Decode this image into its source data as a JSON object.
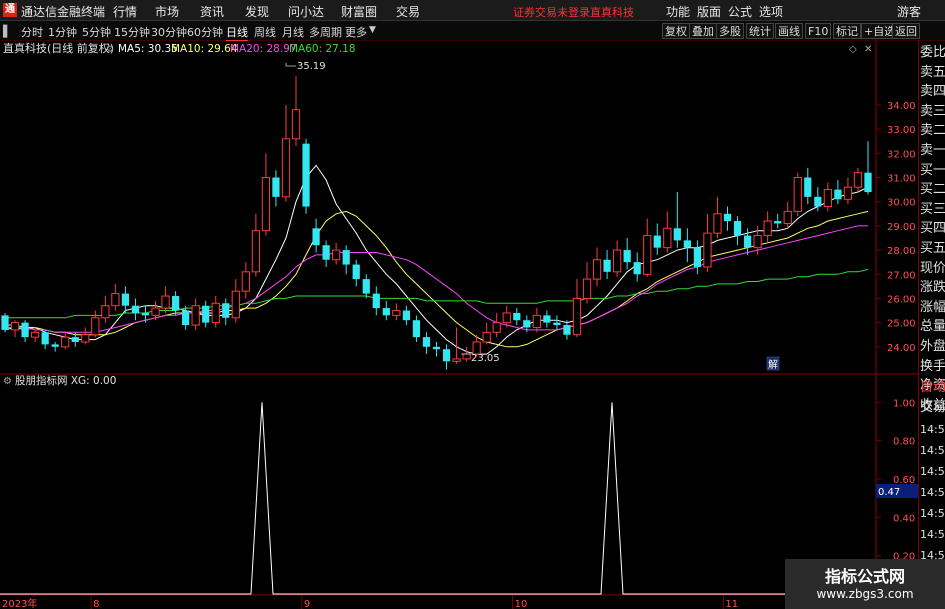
{
  "titlebar": {
    "app_name": "通达信金融终端",
    "menus": [
      "行情",
      "市场",
      "资讯",
      "发现",
      "问小达",
      "财富圈",
      "交易"
    ],
    "status_text": "证券交易未登录",
    "stock_name": "直真科技",
    "right_menus": [
      "功能",
      "版面",
      "公式",
      "选项"
    ],
    "user": "游客"
  },
  "toolbar": {
    "periods": [
      "分时",
      "1分钟",
      "5分钟",
      "15分钟",
      "30分钟",
      "60分钟",
      "日线",
      "周线",
      "月线",
      "多周期",
      "更多"
    ],
    "active_period": "日线",
    "right_buttons": [
      "复权",
      "叠加",
      "多股",
      "统计",
      "画线",
      "F10",
      "标记",
      "+自选",
      "返回"
    ]
  },
  "main_panel": {
    "header": "直真科技(日线 前复权)",
    "ma": [
      {
        "label": "MA5: 30.35",
        "color": "#ffffff"
      },
      {
        "label": "MA10: 29.64",
        "color": "#ffff66"
      },
      {
        "label": "MA20: 28.97",
        "color": "#ff44ff"
      },
      {
        "label": "MA60: 27.18",
        "color": "#33dd33"
      }
    ],
    "high_label": "35.19",
    "low_label": "23.05",
    "badge": "解"
  },
  "indicator_panel": {
    "header": "股朋指标网  XG: 0.00",
    "crosshair_value": "0.47"
  },
  "right_panel": {
    "items": [
      "委比",
      "卖五",
      "卖四",
      "卖三",
      "卖二",
      "卖一",
      "买一",
      "买二",
      "买三",
      "买四",
      "买五",
      "现价",
      "涨跌",
      "涨幅",
      "总量",
      "外盘",
      "换手",
      "净资",
      "收益",
      "自动",
      "交易"
    ],
    "times": [
      "14:56",
      "14:56",
      "14:56",
      "14:56",
      "14:56",
      "14:56",
      "14:56",
      "14:56"
    ]
  },
  "watermark": {
    "line1": "指标公式网",
    "line2": "www.zbgs3.com"
  },
  "colors": {
    "up": "#ff3a3a",
    "down": "#33e6f0",
    "ma5": "#ffffff",
    "ma10": "#ffff66",
    "ma20": "#ff44ff",
    "ma60": "#33dd33",
    "grid": "#7a0000",
    "axis_text": "#ff5050"
  },
  "chart_data": [
    {
      "type": "candlestick",
      "title": "直真科技(日线 前复权)",
      "x_months": [
        "2023年",
        "8",
        "9",
        "10",
        "11"
      ],
      "y_ticks": [
        24,
        25,
        26,
        27,
        28,
        29,
        30,
        31,
        32,
        33,
        34
      ],
      "ylim": [
        23.0,
        35.9
      ],
      "candles": [
        [
          25.3,
          24.7,
          25.4,
          24.6
        ],
        [
          24.7,
          25.0,
          25.1,
          24.4
        ],
        [
          25.0,
          24.4,
          25.1,
          24.2
        ],
        [
          24.4,
          24.6,
          24.8,
          24.2
        ],
        [
          24.6,
          24.1,
          24.7,
          23.9
        ],
        [
          24.1,
          24.0,
          24.2,
          23.8
        ],
        [
          24.0,
          24.4,
          24.6,
          23.9
        ],
        [
          24.4,
          24.2,
          24.6,
          24.0
        ],
        [
          24.2,
          24.5,
          24.8,
          24.1
        ],
        [
          24.5,
          25.2,
          25.5,
          24.4
        ],
        [
          25.2,
          25.7,
          26.1,
          25.0
        ],
        [
          25.7,
          26.2,
          26.6,
          25.5
        ],
        [
          26.2,
          25.7,
          26.5,
          25.4
        ],
        [
          25.7,
          25.4,
          26.0,
          25.1
        ],
        [
          25.4,
          25.3,
          25.7,
          25.0
        ],
        [
          25.3,
          25.6,
          25.9,
          25.1
        ],
        [
          25.6,
          26.1,
          26.5,
          25.4
        ],
        [
          26.1,
          25.5,
          26.3,
          25.3
        ],
        [
          25.5,
          24.9,
          25.7,
          24.7
        ],
        [
          24.9,
          25.7,
          26.0,
          24.7
        ],
        [
          25.7,
          25.0,
          25.9,
          24.8
        ],
        [
          25.0,
          25.8,
          26.1,
          24.8
        ],
        [
          25.8,
          25.2,
          26.0,
          24.9
        ],
        [
          25.2,
          26.3,
          26.8,
          25.0
        ],
        [
          26.3,
          27.1,
          27.5,
          26.0
        ],
        [
          27.1,
          28.8,
          29.5,
          26.9
        ],
        [
          28.8,
          31.0,
          32.0,
          28.6
        ],
        [
          31.0,
          30.2,
          31.3,
          29.8
        ],
        [
          30.2,
          32.6,
          34.0,
          30.0
        ],
        [
          32.6,
          33.8,
          35.19,
          32.3
        ],
        [
          32.4,
          29.8,
          32.6,
          29.5
        ],
        [
          28.9,
          28.2,
          29.3,
          27.9
        ],
        [
          28.2,
          27.6,
          28.4,
          27.3
        ],
        [
          27.6,
          28.0,
          28.3,
          27.4
        ],
        [
          28.0,
          27.4,
          28.2,
          27.0
        ],
        [
          27.4,
          26.8,
          27.6,
          26.5
        ],
        [
          26.8,
          26.2,
          27.0,
          26.0
        ],
        [
          26.2,
          25.6,
          26.5,
          25.3
        ],
        [
          25.6,
          25.3,
          25.9,
          25.1
        ],
        [
          25.3,
          25.5,
          25.8,
          25.1
        ],
        [
          25.5,
          25.1,
          25.7,
          24.9
        ],
        [
          25.1,
          24.4,
          25.3,
          24.2
        ],
        [
          24.4,
          24.0,
          24.6,
          23.7
        ],
        [
          24.0,
          23.9,
          24.2,
          23.6
        ],
        [
          23.9,
          23.4,
          24.1,
          23.05
        ],
        [
          23.4,
          23.5,
          24.8,
          23.3
        ],
        [
          23.5,
          23.7,
          24.0,
          23.4
        ],
        [
          23.7,
          24.2,
          24.5,
          23.6
        ],
        [
          24.2,
          24.6,
          25.0,
          24.1
        ],
        [
          24.6,
          25.0,
          25.4,
          24.4
        ],
        [
          25.0,
          25.4,
          25.7,
          24.8
        ],
        [
          25.4,
          25.1,
          25.6,
          24.9
        ],
        [
          25.1,
          24.8,
          25.3,
          24.6
        ],
        [
          24.8,
          25.3,
          25.6,
          24.6
        ],
        [
          25.3,
          25.0,
          25.5,
          24.8
        ],
        [
          25.0,
          24.9,
          25.3,
          24.7
        ],
        [
          24.9,
          24.5,
          25.1,
          24.3
        ],
        [
          24.5,
          26.0,
          26.8,
          24.4
        ],
        [
          26.0,
          26.8,
          27.5,
          25.8
        ],
        [
          26.8,
          27.6,
          28.1,
          26.5
        ],
        [
          27.6,
          27.1,
          28.0,
          26.8
        ],
        [
          27.1,
          28.0,
          28.4,
          26.9
        ],
        [
          28.0,
          27.5,
          28.5,
          27.2
        ],
        [
          27.5,
          27.0,
          27.9,
          26.7
        ],
        [
          27.0,
          28.6,
          29.3,
          26.9
        ],
        [
          28.6,
          28.1,
          29.1,
          27.8
        ],
        [
          28.1,
          28.9,
          29.6,
          27.9
        ],
        [
          28.9,
          28.4,
          30.4,
          28.1
        ],
        [
          28.4,
          28.1,
          28.9,
          27.5
        ],
        [
          28.1,
          27.3,
          28.4,
          27.0
        ],
        [
          27.3,
          28.7,
          29.5,
          27.1
        ],
        [
          28.7,
          29.5,
          30.2,
          28.5
        ],
        [
          29.5,
          29.2,
          29.8,
          28.8
        ],
        [
          29.2,
          28.6,
          29.4,
          28.2
        ],
        [
          28.6,
          28.1,
          28.9,
          27.8
        ],
        [
          28.1,
          28.6,
          29.0,
          27.8
        ],
        [
          28.6,
          29.2,
          29.6,
          28.3
        ],
        [
          29.2,
          29.1,
          29.5,
          28.9
        ],
        [
          29.1,
          29.6,
          30.0,
          28.9
        ],
        [
          29.6,
          31.0,
          31.2,
          29.4
        ],
        [
          31.0,
          30.2,
          31.4,
          29.9
        ],
        [
          30.2,
          29.8,
          30.6,
          29.6
        ],
        [
          29.8,
          30.5,
          30.8,
          29.6
        ],
        [
          30.5,
          30.1,
          30.9,
          29.9
        ],
        [
          30.1,
          30.6,
          31.0,
          29.9
        ],
        [
          30.6,
          31.2,
          31.4,
          30.4
        ],
        [
          31.2,
          30.4,
          32.5,
          30.3
        ]
      ],
      "ma_series": [
        {
          "name": "MA5",
          "color": "#ffffff",
          "values": [
            24.7,
            24.8,
            24.7,
            24.8,
            24.6,
            24.5,
            24.4,
            24.3,
            24.3,
            24.3,
            24.5,
            25.0,
            25.5,
            25.6,
            25.7,
            25.7,
            25.6,
            25.6,
            25.5,
            25.4,
            25.3,
            25.3,
            25.3,
            25.4,
            25.6,
            26.0,
            26.8,
            27.6,
            28.5,
            30.0,
            31.0,
            31.5,
            30.9,
            29.9,
            29.3,
            28.7,
            28.0,
            27.5,
            27.0,
            26.6,
            26.1,
            25.6,
            25.1,
            24.7,
            24.3,
            24.0,
            23.8,
            23.7,
            23.7,
            24.0,
            24.4,
            24.7,
            24.9,
            25.1,
            25.1,
            25.1,
            25.0,
            25.1,
            25.3,
            25.7,
            26.1,
            26.6,
            27.1,
            27.4,
            27.5,
            27.6,
            27.8,
            28.0,
            28.1,
            28.1,
            28.2,
            28.4,
            28.5,
            28.6,
            28.7,
            28.8,
            28.8,
            28.8,
            28.9,
            29.3,
            29.6,
            29.8,
            30.0,
            30.2,
            30.3,
            30.4,
            30.6
          ]
        },
        {
          "name": "MA10",
          "color": "#ffff66",
          "values": [
            24.9,
            24.9,
            24.8,
            24.8,
            24.7,
            24.6,
            24.6,
            24.5,
            24.5,
            24.5,
            24.5,
            24.6,
            24.8,
            25.0,
            25.1,
            25.2,
            25.3,
            25.4,
            25.4,
            25.4,
            25.4,
            25.4,
            25.5,
            25.5,
            25.6,
            25.6,
            25.8,
            26.1,
            26.5,
            27.0,
            27.8,
            28.6,
            29.2,
            29.5,
            29.6,
            29.4,
            29.0,
            28.6,
            28.1,
            27.5,
            27.0,
            26.6,
            26.2,
            25.8,
            25.4,
            25.0,
            24.7,
            24.4,
            24.2,
            24.1,
            24.0,
            24.0,
            24.1,
            24.3,
            24.5,
            24.7,
            24.8,
            24.9,
            25.0,
            25.2,
            25.4,
            25.6,
            25.9,
            26.2,
            26.4,
            26.7,
            26.9,
            27.1,
            27.3,
            27.5,
            27.7,
            27.8,
            27.9,
            28.0,
            28.1,
            28.2,
            28.3,
            28.4,
            28.5,
            28.7,
            28.9,
            29.0,
            29.2,
            29.3,
            29.4,
            29.5,
            29.6
          ]
        },
        {
          "name": "MA20",
          "color": "#ff44ff",
          "values": [
            24.8,
            24.8,
            24.8,
            24.7,
            24.7,
            24.6,
            24.6,
            24.6,
            24.6,
            24.6,
            24.7,
            24.8,
            24.9,
            25.0,
            25.1,
            25.2,
            25.3,
            25.3,
            25.4,
            25.4,
            25.5,
            25.5,
            25.6,
            25.7,
            25.8,
            26.0,
            26.3,
            26.6,
            26.9,
            27.3,
            27.6,
            27.8,
            27.8,
            27.9,
            27.9,
            27.9,
            27.9,
            27.9,
            27.8,
            27.7,
            27.6,
            27.4,
            27.1,
            26.8,
            26.5,
            26.2,
            25.8,
            25.5,
            25.2,
            25.0,
            24.9,
            24.8,
            24.7,
            24.7,
            24.7,
            24.7,
            24.8,
            24.9,
            25.0,
            25.2,
            25.4,
            25.6,
            25.8,
            26.1,
            26.3,
            26.6,
            26.8,
            27.0,
            27.2,
            27.3,
            27.5,
            27.6,
            27.7,
            27.8,
            27.9,
            28.0,
            28.1,
            28.2,
            28.3,
            28.4,
            28.5,
            28.6,
            28.7,
            28.8,
            28.9,
            29.0,
            29.0
          ]
        },
        {
          "name": "MA60",
          "color": "#33dd33",
          "values": [
            25.2,
            25.2,
            25.2,
            25.2,
            25.2,
            25.2,
            25.2,
            25.3,
            25.3,
            25.3,
            25.3,
            25.3,
            25.4,
            25.4,
            25.4,
            25.5,
            25.5,
            25.5,
            25.6,
            25.6,
            25.6,
            25.7,
            25.7,
            25.7,
            25.8,
            25.8,
            25.9,
            26.0,
            26.0,
            26.1,
            26.1,
            26.1,
            26.1,
            26.1,
            26.1,
            26.1,
            26.1,
            26.0,
            26.0,
            26.0,
            26.0,
            26.0,
            25.9,
            25.9,
            25.9,
            25.9,
            25.9,
            25.9,
            25.8,
            25.8,
            25.8,
            25.8,
            25.8,
            25.8,
            25.9,
            25.9,
            25.9,
            25.9,
            26.0,
            26.0,
            26.0,
            26.1,
            26.1,
            26.2,
            26.2,
            26.3,
            26.3,
            26.4,
            26.4,
            26.5,
            26.5,
            26.6,
            26.6,
            26.6,
            26.7,
            26.7,
            26.8,
            26.8,
            26.8,
            26.9,
            26.9,
            27.0,
            27.0,
            27.0,
            27.1,
            27.1,
            27.2
          ]
        }
      ]
    },
    {
      "type": "line",
      "title": "股朋指标网",
      "y_ticks": [
        0.2,
        0.4,
        0.6,
        0.8,
        1.0
      ],
      "ylim": [
        0,
        1.08
      ],
      "values": [
        0,
        0,
        0,
        0,
        0,
        0,
        0,
        0,
        0,
        0,
        0,
        0,
        0,
        0,
        0,
        0,
        0,
        0,
        0,
        0,
        0,
        0,
        0,
        0,
        0,
        0,
        0,
        0,
        0,
        1,
        0,
        0,
        0,
        0,
        0,
        0,
        0,
        0,
        0,
        0,
        0,
        0,
        0,
        0,
        0,
        0,
        0,
        0,
        0,
        0,
        0,
        0,
        0,
        0,
        0,
        0,
        0,
        0,
        0,
        0,
        0,
        0,
        0,
        0,
        0,
        0,
        0,
        0,
        0,
        0,
        0,
        0,
        0,
        0,
        0,
        0,
        0,
        0,
        0,
        0,
        0,
        0,
        0,
        0,
        0,
        0,
        0
      ],
      "values_note": ""
    }
  ]
}
